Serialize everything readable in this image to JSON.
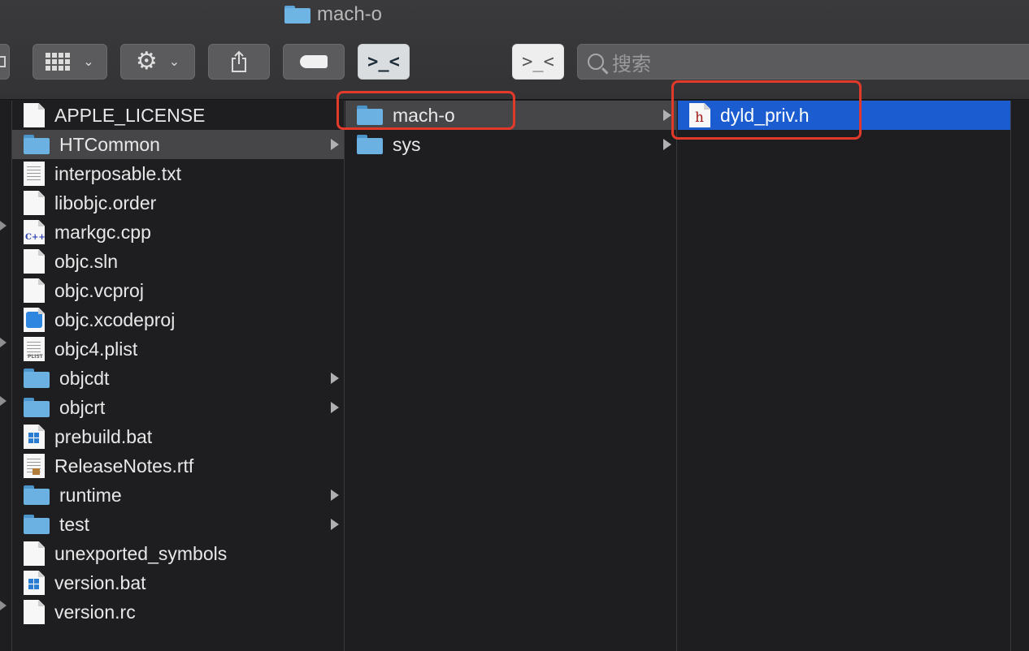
{
  "window": {
    "title": "mach-o"
  },
  "toolbar": {
    "search_placeholder": "搜索",
    "buttons": [
      {
        "name": "view-options",
        "icon": "grid-view-icon"
      },
      {
        "name": "action",
        "icon": "gear-icon"
      },
      {
        "name": "share",
        "icon": "share-icon"
      },
      {
        "name": "tags",
        "icon": "tag-icon"
      },
      {
        "name": "terminal-active",
        "icon": "terminal-icon",
        "label": ">_<"
      },
      {
        "name": "terminal",
        "icon": "terminal-icon",
        "label": ">_<"
      }
    ]
  },
  "columns": [
    {
      "items": [
        {
          "label": "APPLE_LICENSE",
          "icon": "document-icon",
          "folder": false
        },
        {
          "label": "HTCommon",
          "icon": "folder-icon",
          "folder": true,
          "selected": true
        },
        {
          "label": "interposable.txt",
          "icon": "text-file-icon",
          "folder": false
        },
        {
          "label": "libobjc.order",
          "icon": "document-icon",
          "folder": false
        },
        {
          "label": "markgc.cpp",
          "icon": "cpp-file-icon",
          "folder": false,
          "badge": "C++"
        },
        {
          "label": "objc.sln",
          "icon": "document-icon",
          "folder": false
        },
        {
          "label": "objc.vcproj",
          "icon": "document-icon",
          "folder": false
        },
        {
          "label": "objc.xcodeproj",
          "icon": "xcode-project-icon",
          "folder": false
        },
        {
          "label": "objc4.plist",
          "icon": "plist-file-icon",
          "folder": false,
          "badge": "PLIST"
        },
        {
          "label": "objcdt",
          "icon": "folder-icon",
          "folder": true
        },
        {
          "label": "objcrt",
          "icon": "folder-icon",
          "folder": true
        },
        {
          "label": "prebuild.bat",
          "icon": "batch-file-icon",
          "folder": false
        },
        {
          "label": "ReleaseNotes.rtf",
          "icon": "rtf-file-icon",
          "folder": false
        },
        {
          "label": "runtime",
          "icon": "folder-icon",
          "folder": true
        },
        {
          "label": "test",
          "icon": "folder-icon",
          "folder": true
        },
        {
          "label": "unexported_symbols",
          "icon": "document-icon",
          "folder": false
        },
        {
          "label": "version.bat",
          "icon": "batch-file-icon",
          "folder": false
        },
        {
          "label": "version.rc",
          "icon": "document-icon",
          "folder": false
        }
      ]
    },
    {
      "items": [
        {
          "label": "mach-o",
          "icon": "folder-icon",
          "folder": true,
          "selected": true
        },
        {
          "label": "sys",
          "icon": "folder-icon",
          "folder": true
        }
      ]
    },
    {
      "items": [
        {
          "label": "dyld_priv.h",
          "icon": "header-file-icon",
          "folder": false,
          "selected": true,
          "badge": "h"
        }
      ]
    }
  ],
  "colors": {
    "selection_active": "#1b5dd1",
    "selection_inactive": "#464648",
    "annotation": "#e23a2a"
  }
}
